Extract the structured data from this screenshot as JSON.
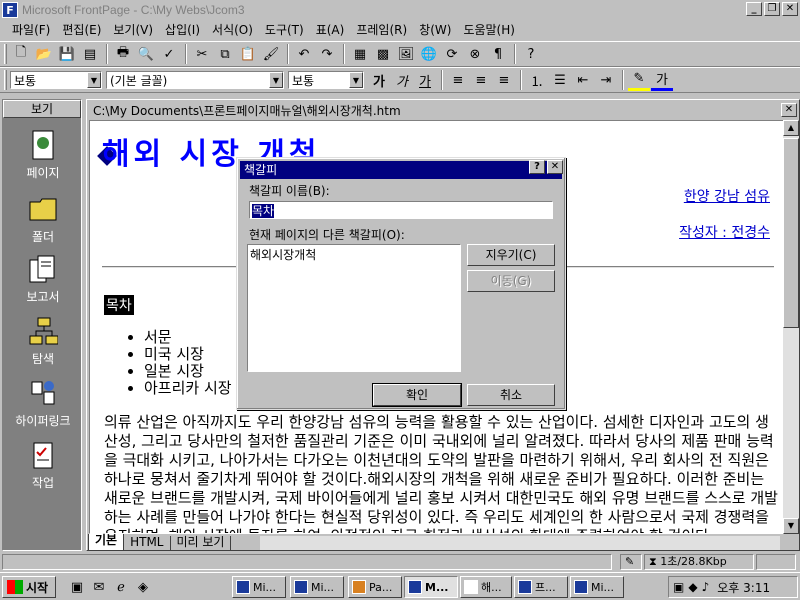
{
  "titlebar": {
    "title": "Microsoft FrontPage - C:\\My Webs\\Jcom3"
  },
  "menu": [
    "파일(F)",
    "편집(E)",
    "보기(V)",
    "삽입(I)",
    "서식(O)",
    "도구(T)",
    "표(A)",
    "프레임(R)",
    "창(W)",
    "도움말(H)"
  ],
  "format": {
    "style": "보통",
    "font": "(기본 글꼴)",
    "size": "보통"
  },
  "views": {
    "header": "보기",
    "items": [
      "페이지",
      "폴더",
      "보고서",
      "탐색",
      "하이퍼링크",
      "작업"
    ]
  },
  "document": {
    "path": "C:\\My Documents\\프론트페이지매뉴얼\\해외시장개척.htm",
    "heading": "해외 시장 개척",
    "link1": "한양 강남 섬유",
    "link2": "작성자 : 전경수",
    "toc": "목차",
    "list": [
      "서문",
      "미국 시장",
      "일본 시장",
      "아프리카 시장"
    ],
    "paragraph": "의류 산업은 아직까지도 우리 한양강남 섬유의 능력을 활용할 수 있는 산업이다. 섬세한 디자인과 고도의 생산성, 그리고 당사만의 철저한 품질관리 기준은 이미 국내외에 널리 알려졌다. 따라서 당사의 제품 판매 능력을 극대화 시키고, 나아가서는 다가오는 이천년대의 도약의 발판을 마련하기 위해서, 우리 회사의 전 직원은 하나로 뭉쳐서 줄기차게 뛰어야 할 것이다.해외시장의 개척을 위해 새로운 준비가 필요하다. 이러한 준비는 새로운 브랜드를 개발시켜, 국제 바이어들에게 널리 홍보 시켜서 대한민국도 해외 유명 브랜드를 스스로 개발하는 사례를 만들어 나가야 한다는 현실적 당위성이 있다. 즉 우리도 세계인의 한 사람으로서 국제 경쟁력을 유지하며, 해외 시장에 투자를 하여, 안정적인 자금 회전과 생산성의 확대에 주력하여야 할 것이다."
  },
  "viewtabs": [
    "기본",
    "HTML",
    "미리 보기"
  ],
  "status": {
    "time_estimate": "1초/28.8Kbp"
  },
  "dialog": {
    "title": "책갈피",
    "name_label": "책갈피 이름(B):",
    "name_value": "목차",
    "other_label": "현재 페이지의 다른 책갈피(O):",
    "other_items": [
      "해외시장개척"
    ],
    "delete_btn": "지우기(C)",
    "goto_btn": "이동(G)",
    "ok_btn": "확인",
    "cancel_btn": "취소"
  },
  "taskbar": {
    "start": "시작",
    "tasks": [
      "Mi...",
      "Mi...",
      "Pa...",
      "M...",
      "해...",
      "프...",
      "Mi..."
    ],
    "clock": "오후 3:11"
  }
}
